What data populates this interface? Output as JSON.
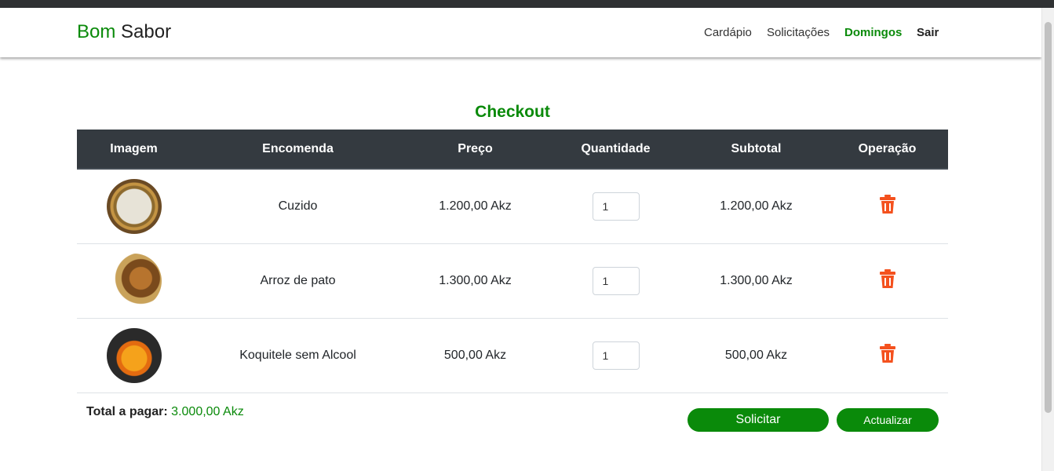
{
  "brand": {
    "part1": "Bom",
    "part2": "Sabor"
  },
  "nav": {
    "items": [
      "Cardápio",
      "Solicitações",
      "Domingos",
      "Sair"
    ]
  },
  "page": {
    "title": "Checkout"
  },
  "table": {
    "headers": [
      "Imagem",
      "Encomenda",
      "Preço",
      "Quantidade",
      "Subtotal",
      "Operação"
    ],
    "rows": [
      {
        "name": "Cuzido",
        "price": "1.200,00 Akz",
        "qty": "1",
        "subtotal": "1.200,00 Akz"
      },
      {
        "name": "Arroz de pato",
        "price": "1.300,00 Akz",
        "qty": "1",
        "subtotal": "1.300,00 Akz"
      },
      {
        "name": "Koquitele sem Alcool",
        "price": "500,00 Akz",
        "qty": "1",
        "subtotal": "500,00 Akz"
      }
    ]
  },
  "total": {
    "label": "Total a pagar:",
    "value": "3.000,00 Akz"
  },
  "buttons": {
    "solicitar": "Solicitar",
    "actualizar": "Actualizar"
  },
  "icons": {
    "delete": "trash-icon"
  },
  "colors": {
    "accent": "#0a8a0a",
    "header_bg": "#343a40",
    "delete": "#f4511e"
  }
}
